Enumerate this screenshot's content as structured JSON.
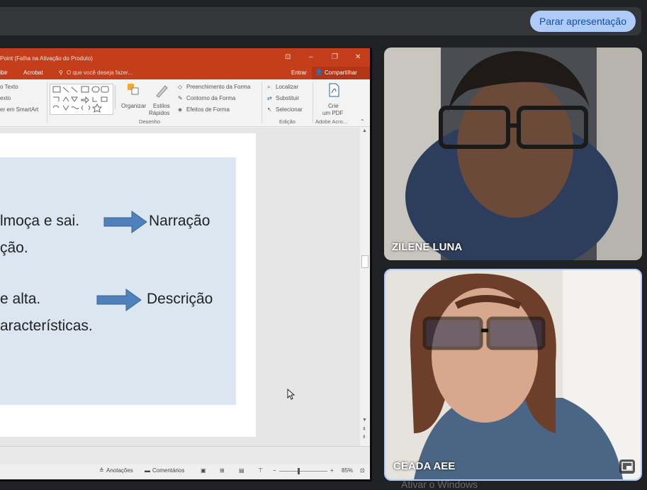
{
  "meet": {
    "stop_presenting": "Parar apresentação",
    "participants": [
      {
        "name": "ZILENE LUNA"
      },
      {
        "name": "CEADA AEE"
      }
    ],
    "watermark": "Ativar o Windows"
  },
  "powerpoint": {
    "title": "Point (Falha na Ativação do Produto)",
    "menu": {
      "exibir": "ibir",
      "acrobat": "Acrobat",
      "search_placeholder": "O que você deseja fazer...",
      "entrar": "Entrar",
      "share": "Compartilhar"
    },
    "ribbon": {
      "paragraph_items": [
        "o Texto",
        "exto",
        "er em SmartArt"
      ],
      "arrange": "Organizar",
      "quick_styles": [
        "Estilos",
        "Rápidos"
      ],
      "shape_fill": "Preenchimento da Forma",
      "shape_outline": "Contorno da Forma",
      "shape_effects": "Efeitos de Forma",
      "drawing_group": "Desenho",
      "find": "Localizar",
      "replace": "Substituir",
      "select": "Selecionar",
      "editing_group": "Edição",
      "create_pdf": [
        "Crie",
        "um PDF"
      ],
      "adobe_group": "Adobe Acro..."
    },
    "slide": {
      "line1_left": "lmoça e sai.",
      "line1_right": "Narração",
      "line2_left": "ção.",
      "line3_left": "e alta.",
      "line3_right": "Descrição",
      "line4_left": "aracterísticas."
    },
    "status": {
      "notes": "Anotações",
      "comments": "Comentários",
      "zoom": "85%"
    }
  },
  "colors": {
    "ppt_accent": "#c43e1c",
    "slide_box": "#dce6f1",
    "arrow": "#4f81bd",
    "stop_button": "#aecbfa"
  }
}
